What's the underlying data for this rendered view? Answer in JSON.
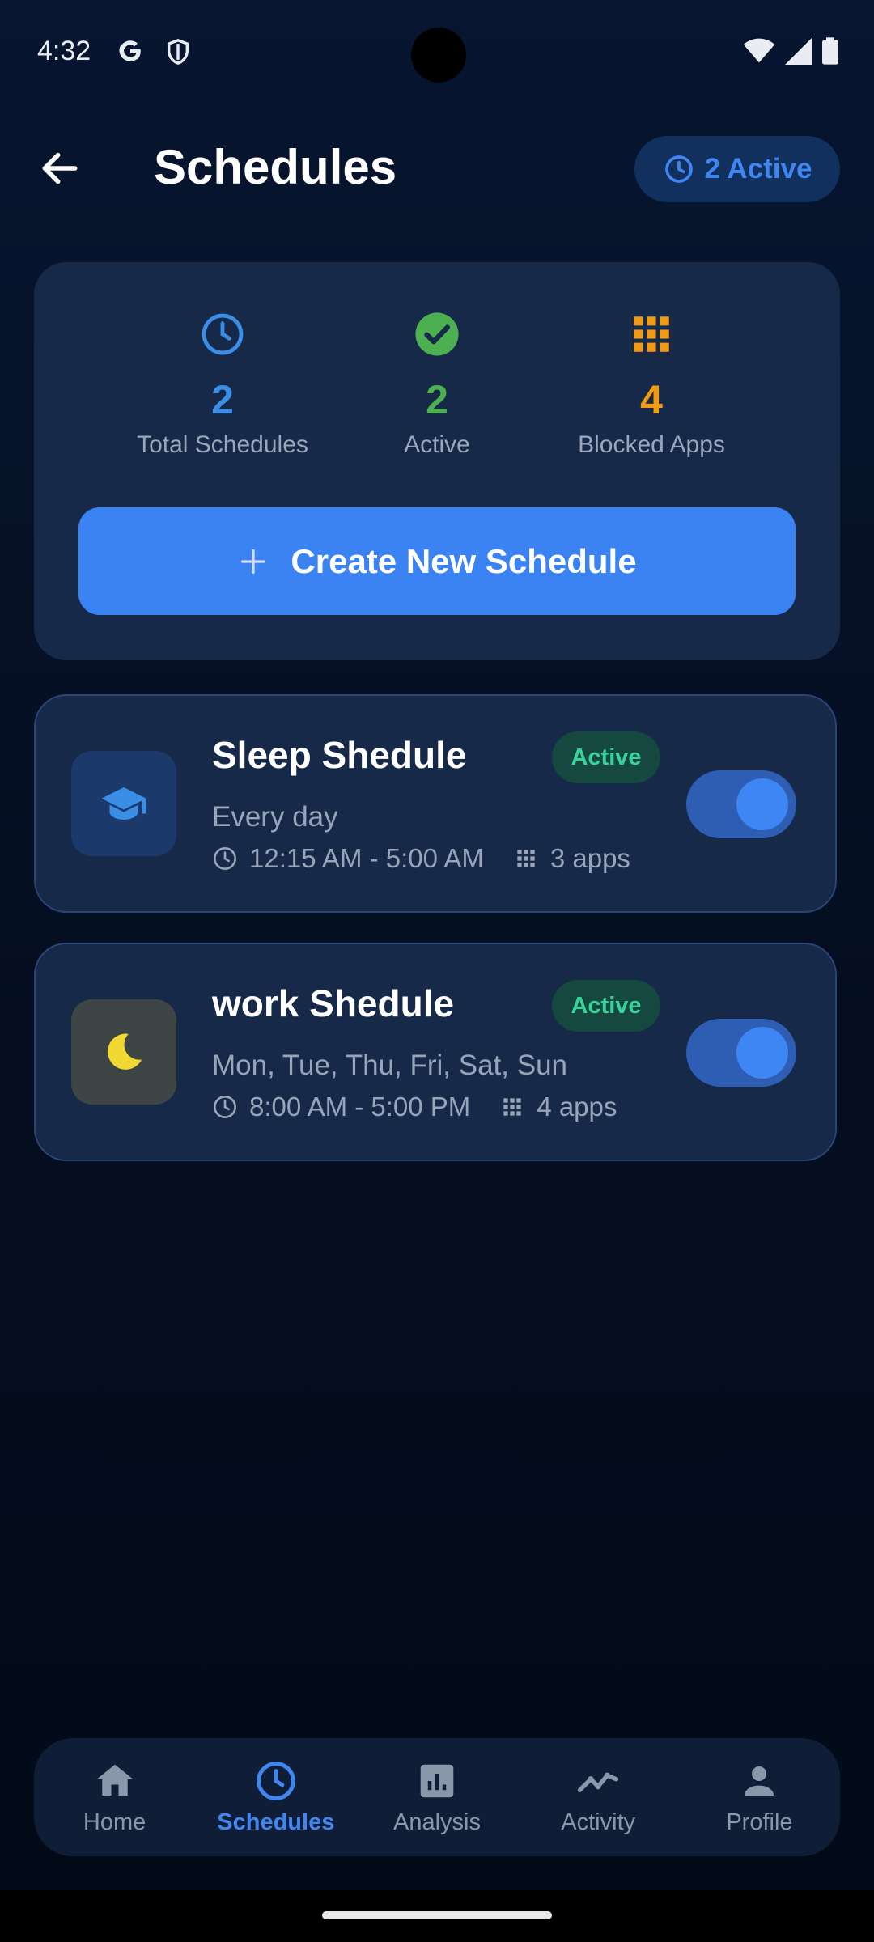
{
  "status_bar": {
    "time": "4:32"
  },
  "header": {
    "title": "Schedules",
    "active_badge": "2 Active"
  },
  "stats": {
    "total": {
      "value": "2",
      "label": "Total Schedules",
      "color": "#3a8ee6"
    },
    "active": {
      "value": "2",
      "label": "Active",
      "color": "#4caf50"
    },
    "blocked": {
      "value": "4",
      "label": "Blocked Apps",
      "color": "#f29a12"
    }
  },
  "create_button": {
    "label": "Create New Schedule"
  },
  "schedules": [
    {
      "name": "Sleep Shedule",
      "status": "Active",
      "days": "Every day",
      "time": "12:15 AM - 5:00 AM",
      "apps": "3 apps",
      "icon": "graduation-cap-icon",
      "enabled": true
    },
    {
      "name": "work Shedule",
      "status": "Active",
      "days": "Mon, Tue, Thu, Fri, Sat, Sun",
      "time": "8:00 AM - 5:00 PM",
      "apps": "4 apps",
      "icon": "moon-icon",
      "enabled": true
    }
  ],
  "nav": [
    {
      "label": "Home",
      "icon": "home-icon"
    },
    {
      "label": "Schedules",
      "icon": "clock-icon",
      "selected": true
    },
    {
      "label": "Analysis",
      "icon": "bar-chart-icon"
    },
    {
      "label": "Activity",
      "icon": "trend-line-icon"
    },
    {
      "label": "Profile",
      "icon": "person-icon"
    }
  ]
}
